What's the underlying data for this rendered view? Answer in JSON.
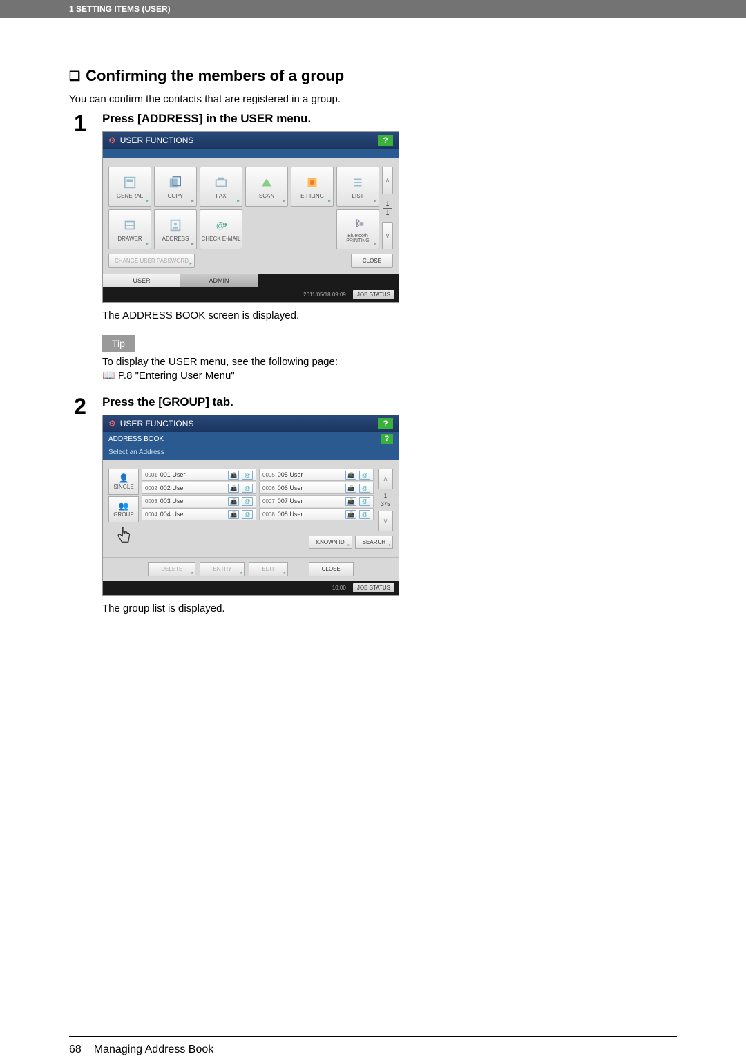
{
  "header": {
    "breadcrumb": "1 SETTING ITEMS (USER)"
  },
  "section": {
    "title": "Confirming the members of a group",
    "desc": "You can confirm the contacts that are registered in a group."
  },
  "step1": {
    "num": "1",
    "title": "Press [ADDRESS] in the USER menu.",
    "after": "The ADDRESS BOOK screen is displayed.",
    "tip_label": "Tip",
    "tip_text": "To display the USER menu, see the following page:",
    "tip_ref": "📖 P.8 \"Entering User Menu\""
  },
  "screenshot1": {
    "title": "USER FUNCTIONS",
    "help": "?",
    "cells_row1": [
      "GENERAL",
      "COPY",
      "FAX",
      "SCAN",
      "E-FILING",
      "LIST"
    ],
    "cells_row2": [
      "DRAWER",
      "ADDRESS",
      "CHECK E-MAIL",
      "",
      "",
      "Bluetooth PRINTING"
    ],
    "change_pass": "CHANGE USER PASSWORD",
    "close": "CLOSE",
    "page_top": "1",
    "page_bot": "1",
    "tabs": {
      "user": "USER",
      "admin": "ADMIN"
    },
    "status_time": "2011/05/18 09:09",
    "job_status": "JOB STATUS"
  },
  "step2": {
    "num": "2",
    "title": "Press the [GROUP] tab.",
    "after": "The group list is displayed."
  },
  "screenshot2": {
    "title": "USER FUNCTIONS",
    "subtitle": "ADDRESS BOOK",
    "instruct": "Select an Address",
    "help": "?",
    "sidetabs": {
      "single": "SINGLE",
      "group": "GROUP"
    },
    "rows_left": [
      {
        "id": "0001",
        "name": "001 User"
      },
      {
        "id": "0002",
        "name": "002 User"
      },
      {
        "id": "0003",
        "name": "003 User"
      },
      {
        "id": "0004",
        "name": "004 User"
      }
    ],
    "rows_right": [
      {
        "id": "0005",
        "name": "005 User"
      },
      {
        "id": "0006",
        "name": "006 User"
      },
      {
        "id": "0007",
        "name": "007 User"
      },
      {
        "id": "0008",
        "name": "008 User"
      }
    ],
    "count_top": "1",
    "count_bot": "375",
    "known_id": "KNOWN ID",
    "search": "SEARCH",
    "delete": "DELETE",
    "entry": "ENTRY",
    "edit": "EDIT",
    "close": "CLOSE",
    "status_time": "10:00",
    "job_status": "JOB STATUS"
  },
  "footer": {
    "page": "68",
    "title": "Managing Address Book"
  }
}
